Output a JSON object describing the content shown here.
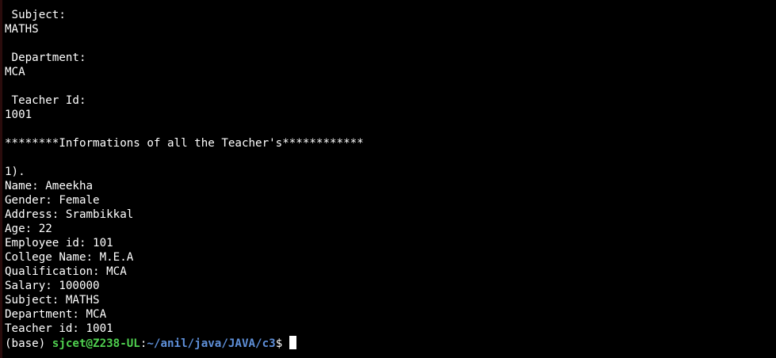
{
  "terminal": {
    "lines": [
      " Subject:",
      "MATHS",
      "",
      " Department:",
      "MCA",
      "",
      " Teacher Id:",
      "1001",
      "",
      "********Informations of all the Teacher's************",
      "",
      "1).",
      "Name: Ameekha",
      "Gender: Female",
      "Address: Srambikkal",
      "Age: 22",
      "Employee id: 101",
      "College Name: M.E.A",
      "Qualification: MCA",
      "Salary: 100000",
      "Subject: MATHS",
      "Department: MCA",
      "Teacher id: 1001"
    ],
    "prompt": {
      "env": "(base) ",
      "user_host": "sjcet@Z238-UL",
      "separator": ":",
      "path": "~/anil/java/JAVA/c3",
      "symbol": "$"
    },
    "colors": {
      "background": "#000000",
      "text": "#ffffff",
      "user_host": "#4fd04f",
      "path": "#5e8fd8"
    }
  }
}
